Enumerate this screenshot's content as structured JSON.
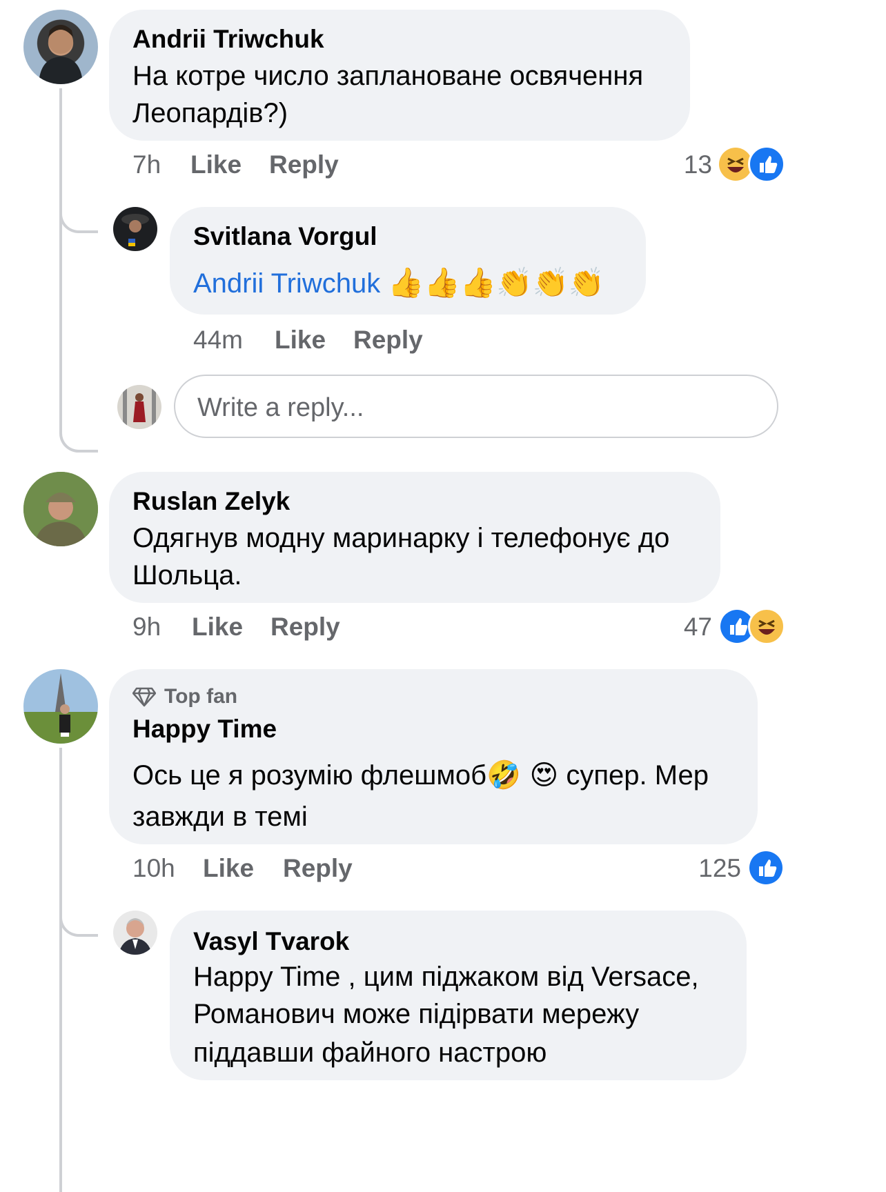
{
  "colors": {
    "bubble": "#f0f2f5",
    "meta_text": "#65676b",
    "like_blue": "#1877f2",
    "haha_yellow": "#f7c04a",
    "mention_blue": "#216fdb",
    "thread_line": "#ced0d4"
  },
  "comments": [
    {
      "author": "Andrii Triwchuk",
      "text_line1": "На котре число заплановане освячення",
      "text_line2": "Леопардів?)",
      "time": "7h",
      "like": "Like",
      "reply": "Reply",
      "reaction_count": "13",
      "reactions": [
        "haha-icon",
        "like-icon"
      ],
      "replies": [
        {
          "author": "Svitlana Vorgul",
          "mention": "Andrii Triwchuk",
          "emoji": "👍👍👍👏👏👏",
          "time": "44m",
          "like": "Like",
          "reply": "Reply"
        }
      ],
      "reply_box_placeholder": "Write a reply..."
    },
    {
      "author": "Ruslan Zelyk",
      "text_line1": "Одягнув модну маринарку і телефонує до",
      "text_line2": "Шольца.",
      "time": "9h",
      "like": "Like",
      "reply": "Reply",
      "reaction_count": "47",
      "reactions": [
        "like-icon",
        "haha-icon"
      ]
    },
    {
      "badge": "Top fan",
      "author": "Happy Time",
      "text_line1_a": "Ось це я розумію флешмоб",
      "text_line1_emoji": "🤣 😍",
      "text_line1_b": " супер. Мер",
      "text_line2": "завжди в темі",
      "time": "10h",
      "like": "Like",
      "reply": "Reply",
      "reaction_count": "125",
      "reactions": [
        "like-icon"
      ],
      "replies": [
        {
          "author": "Vasyl Tvarok",
          "text_line1": "Happy Time , цим піджаком від Versace,",
          "text_line2": "Романович може підірвати мережу",
          "text_line3": "піддавши файного настрою"
        }
      ]
    }
  ]
}
